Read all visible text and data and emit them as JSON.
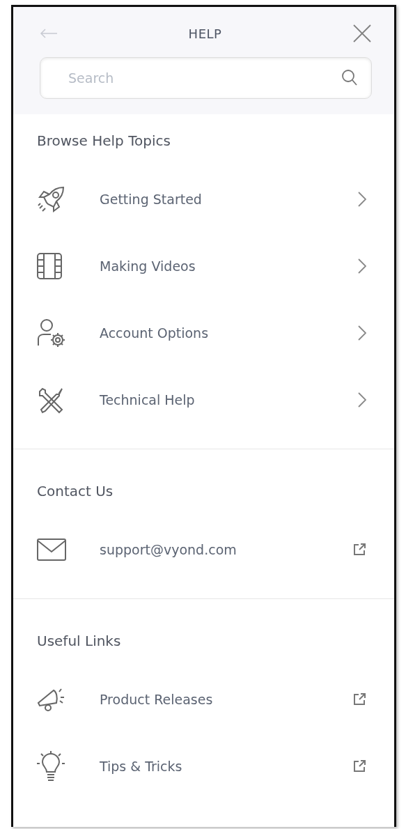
{
  "header": {
    "title": "HELP",
    "search": {
      "placeholder": "Search"
    }
  },
  "sections": [
    {
      "heading": "Browse Help Topics",
      "items": [
        {
          "label": "Getting Started"
        },
        {
          "label": "Making Videos"
        },
        {
          "label": "Account Options"
        },
        {
          "label": "Technical Help"
        }
      ]
    },
    {
      "heading": "Contact Us",
      "items": [
        {
          "label": "support@vyond.com"
        }
      ]
    },
    {
      "heading": "Useful Links",
      "items": [
        {
          "label": "Product Releases"
        },
        {
          "label": "Tips & Tricks"
        }
      ]
    }
  ]
}
